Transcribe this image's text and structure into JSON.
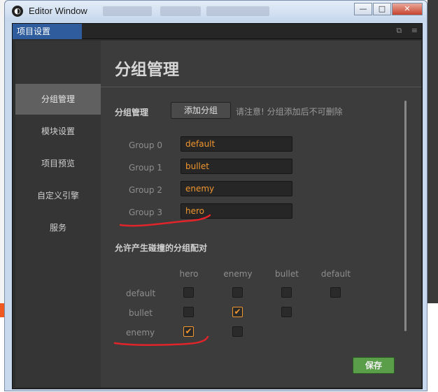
{
  "window": {
    "title": "Editor Window"
  },
  "window_controls": {
    "minimize": "—",
    "maximize": "□",
    "close": "✕"
  },
  "tab": {
    "label": "项目设置"
  },
  "sidebar": {
    "items": [
      {
        "label": "分组管理",
        "active": true
      },
      {
        "label": "模块设置",
        "active": false
      },
      {
        "label": "项目预览",
        "active": false
      },
      {
        "label": "自定义引擎",
        "active": false
      },
      {
        "label": "服务",
        "active": false
      }
    ]
  },
  "main": {
    "title": "分组管理",
    "group_section_label": "分组管理",
    "add_group_button": "添加分组",
    "note": "请注意! 分组添加后不可删除",
    "groups": [
      {
        "label": "Group 0",
        "value": "default"
      },
      {
        "label": "Group 1",
        "value": "bullet"
      },
      {
        "label": "Group 2",
        "value": "enemy"
      },
      {
        "label": "Group 3",
        "value": "hero"
      }
    ],
    "collision_section_label": "允许产生碰撞的分组配对",
    "matrix": {
      "columns": [
        "hero",
        "enemy",
        "bullet",
        "default"
      ],
      "rows": [
        {
          "label": "default",
          "cells": [
            false,
            false,
            false,
            true
          ]
        },
        {
          "label": "bullet",
          "cells": [
            false,
            true,
            false
          ]
        },
        {
          "label": "enemy",
          "cells": [
            true,
            false
          ]
        }
      ],
      "check_mark": "✔"
    },
    "save_button": "保存"
  },
  "colors": {
    "accent_orange": "#f0962e",
    "tab_blue": "#2e5c9c",
    "save_green": "#5a9e4a",
    "annotation_red": "#e0242a"
  }
}
